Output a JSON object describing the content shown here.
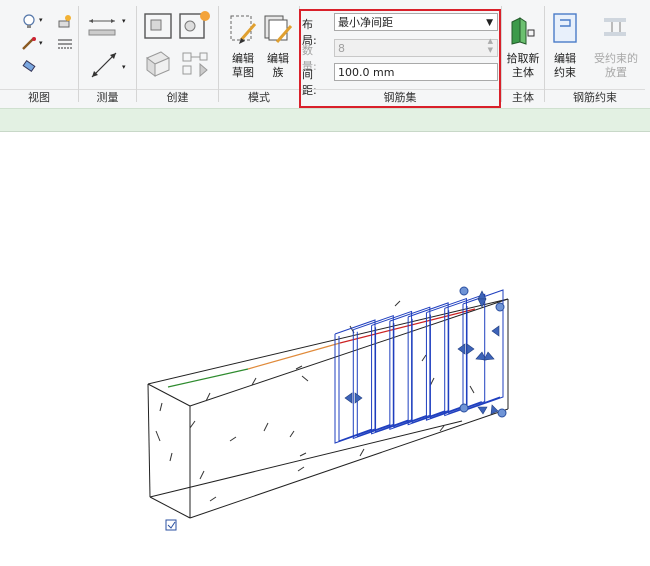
{
  "ribbon": {
    "panels": {
      "view": "视图",
      "measure": "测量",
      "create": "创建",
      "mode": "模式",
      "rebar_set": "钢筋集",
      "host": "主体",
      "rebar_constraints": "钢筋约束"
    },
    "buttons": {
      "edit_sketch": [
        "编辑",
        "草图"
      ],
      "edit_family": [
        "编辑",
        "族"
      ],
      "pick_new_host": [
        "拾取新",
        "主体"
      ],
      "edit_constraints": [
        "编辑",
        "约束"
      ],
      "constrained_placement": [
        "受约束的",
        "放置"
      ]
    },
    "rebar_set": {
      "layout_label": "布局:",
      "layout_value": "最小净间距",
      "quantity_label": "数量:",
      "quantity_value": "8",
      "spacing_label": "间距:",
      "spacing_value": "100.0 mm"
    },
    "colors": {
      "highlight": "#d9202a",
      "rebar": "#1f3fbf",
      "edge_green": "#2e8b2e",
      "edge_orange": "#e08a3a",
      "edge_red": "#cc2222"
    }
  }
}
